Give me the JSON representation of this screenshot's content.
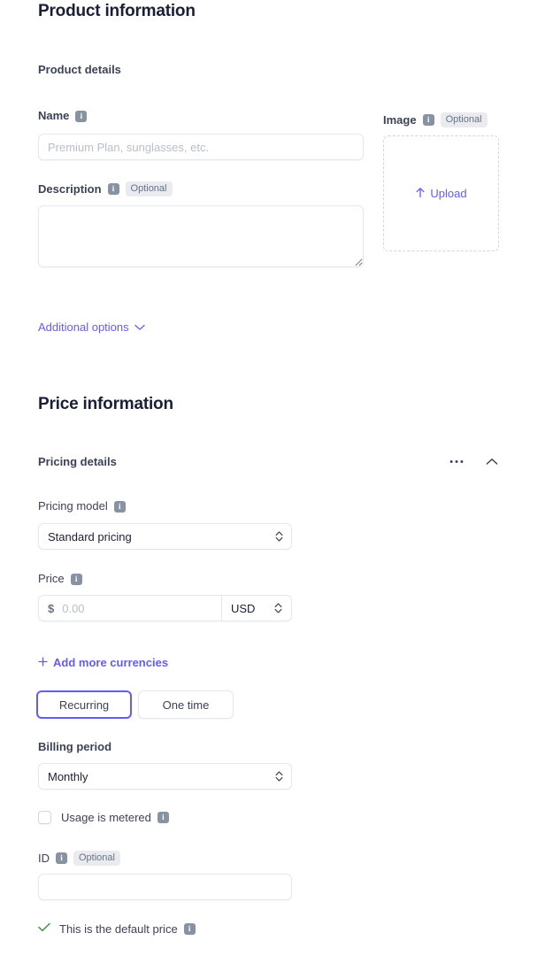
{
  "product_section": {
    "title": "Product information",
    "subtitle": "Product details",
    "name": {
      "label": "Name",
      "info_icon": "info-icon",
      "placeholder": "Premium Plan, sunglasses, etc.",
      "value": ""
    },
    "description": {
      "label": "Description",
      "info_icon": "info-icon",
      "badge": "Optional",
      "placeholder": "",
      "value": ""
    },
    "image": {
      "label": "Image",
      "info_icon": "info-icon",
      "badge": "Optional",
      "upload_label": "Upload",
      "upload_icon": "arrow-up-icon"
    },
    "additional_options": {
      "label": "Additional options",
      "chevron_icon": "chevron-down-icon"
    }
  },
  "price_section": {
    "title": "Price information",
    "subtitle": "Pricing details",
    "overflow_icon": "ellipsis-icon",
    "collapse_icon": "chevron-up-icon",
    "pricing_model": {
      "label": "Pricing model",
      "info_icon": "info-icon",
      "value": "Standard pricing",
      "chevron_icon": "chevron-up-down-icon"
    },
    "price": {
      "label": "Price",
      "info_icon": "info-icon",
      "currency_symbol": "$",
      "placeholder": "0.00",
      "value": "",
      "currency_value": "USD",
      "chevron_icon": "chevron-up-down-icon"
    },
    "add_currencies": {
      "label": "Add more currencies",
      "plus_icon": "plus-icon"
    },
    "billing_type": {
      "options": [
        {
          "label": "Recurring",
          "selected": true
        },
        {
          "label": "One time",
          "selected": false
        }
      ]
    },
    "billing_period": {
      "label": "Billing period",
      "value": "Monthly",
      "chevron_icon": "chevron-up-down-icon"
    },
    "usage_metered": {
      "label": "Usage is metered",
      "info_icon": "info-icon",
      "checked": false
    },
    "id_field": {
      "label": "ID",
      "info_icon": "info-icon",
      "badge": "Optional",
      "value": "",
      "placeholder": ""
    },
    "default_price": {
      "label": "This is the default price",
      "check_icon": "check-icon",
      "info_icon": "info-icon"
    }
  },
  "colors": {
    "accent": "#635bff",
    "success": "#3d9140",
    "text": "#1a1f36",
    "muted": "#697386",
    "border": "#e3e8ee"
  }
}
